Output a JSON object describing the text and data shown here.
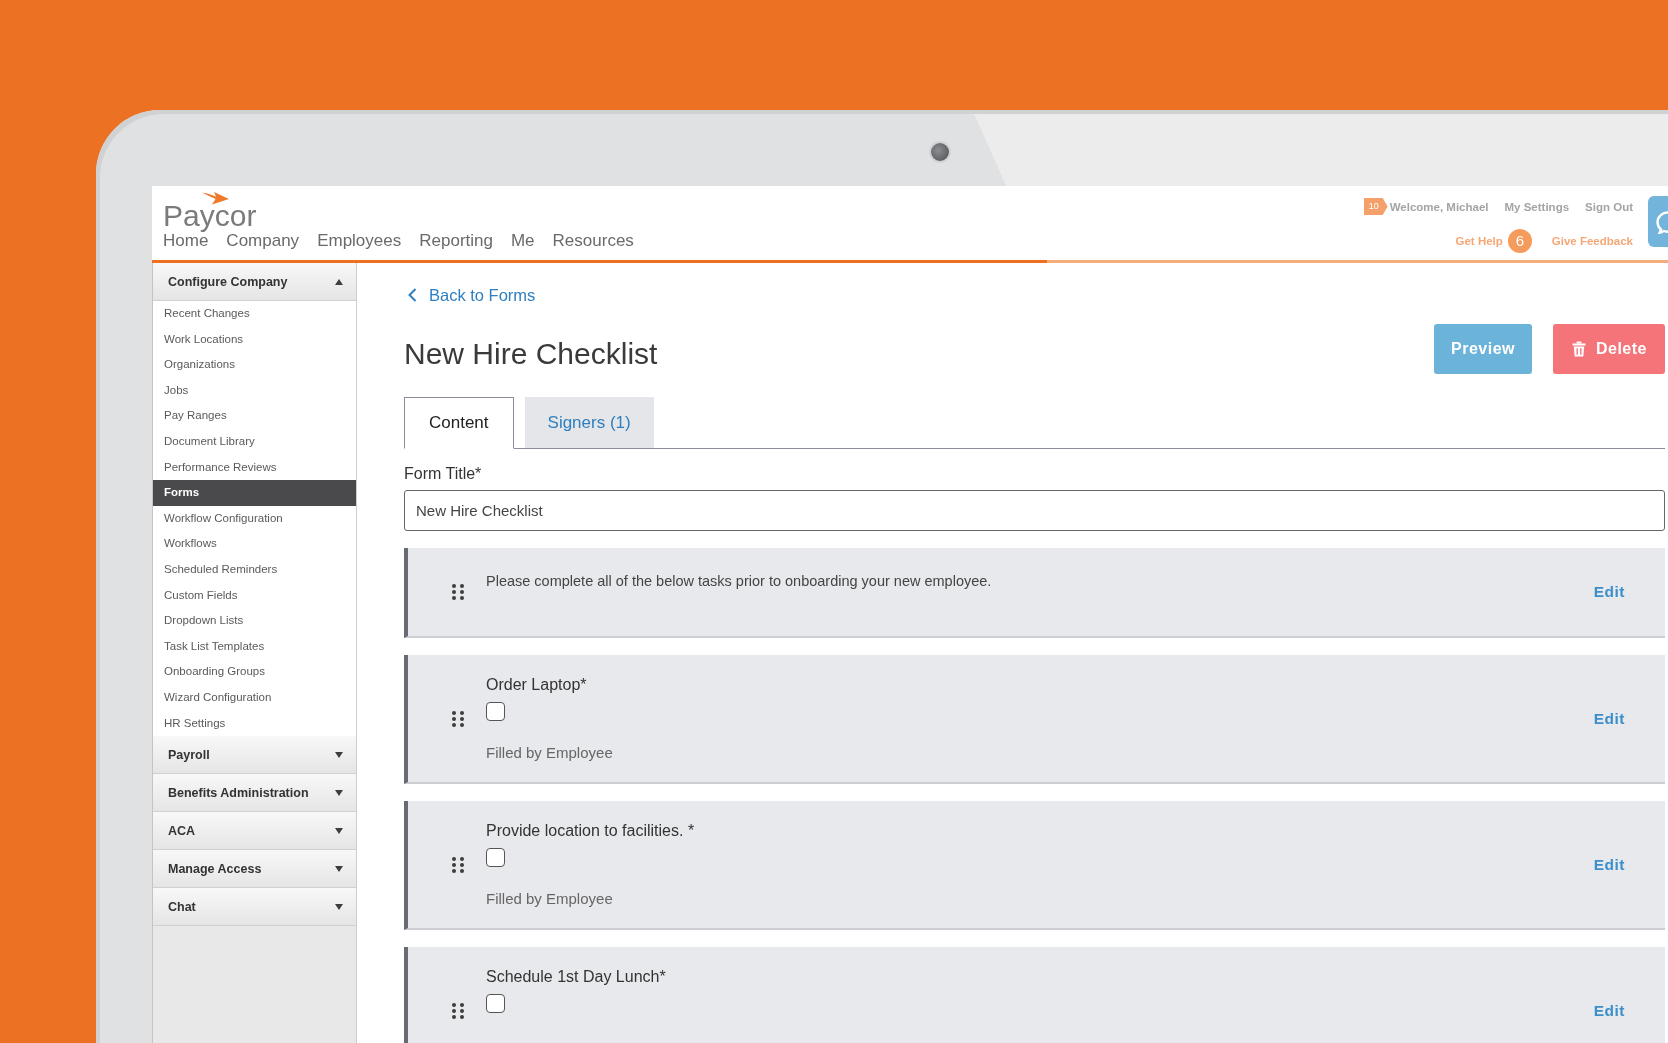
{
  "header": {
    "logo": "Paycor",
    "nav": [
      {
        "label": "Home"
      },
      {
        "label": "Company"
      },
      {
        "label": "Employees"
      },
      {
        "label": "Reporting"
      },
      {
        "label": "Me"
      },
      {
        "label": "Resources"
      }
    ],
    "notification_count": "10",
    "welcome": "Welcome, Michael",
    "account_links": [
      {
        "label": "My Settings"
      },
      {
        "label": "Sign Out"
      }
    ],
    "help": {
      "label": "Get Help",
      "count": "6"
    },
    "feedback": "Give Feedback"
  },
  "sidebar": {
    "sections": [
      {
        "label": "Configure Company",
        "expanded": true,
        "items": [
          {
            "label": "Recent Changes",
            "selected": false
          },
          {
            "label": "Work Locations",
            "selected": false
          },
          {
            "label": "Organizations",
            "selected": false
          },
          {
            "label": "Jobs",
            "selected": false
          },
          {
            "label": "Pay Ranges",
            "selected": false
          },
          {
            "label": "Document Library",
            "selected": false
          },
          {
            "label": "Performance Reviews",
            "selected": false
          },
          {
            "label": "Forms",
            "selected": true
          },
          {
            "label": "Workflow Configuration",
            "selected": false
          },
          {
            "label": "Workflows",
            "selected": false
          },
          {
            "label": "Scheduled Reminders",
            "selected": false
          },
          {
            "label": "Custom Fields",
            "selected": false
          },
          {
            "label": "Dropdown Lists",
            "selected": false
          },
          {
            "label": "Task List Templates",
            "selected": false
          },
          {
            "label": "Onboarding Groups",
            "selected": false
          },
          {
            "label": "Wizard Configuration",
            "selected": false
          },
          {
            "label": "HR Settings",
            "selected": false
          }
        ]
      },
      {
        "label": "Payroll",
        "expanded": false
      },
      {
        "label": "Benefits Administration",
        "expanded": false
      },
      {
        "label": "ACA",
        "expanded": false
      },
      {
        "label": "Manage Access",
        "expanded": false
      },
      {
        "label": "Chat",
        "expanded": false
      }
    ]
  },
  "back_link": "Back to Forms",
  "page_title": "New Hire Checklist",
  "actions": [
    {
      "kind": "preview",
      "label": "Preview"
    },
    {
      "kind": "delete",
      "label": "Delete"
    }
  ],
  "tabs": [
    {
      "label": "Content",
      "selected": true
    },
    {
      "label": "Signers (1)",
      "selected": false
    }
  ],
  "form_title": {
    "label": "Form Title*",
    "value": "New Hire Checklist"
  },
  "fields": [
    {
      "kind": "text",
      "text": "Please complete all of the below tasks prior to onboarding your new employee.",
      "action": "Edit"
    },
    {
      "kind": "checkbox",
      "label": "Order Laptop*",
      "checked": false,
      "filled_by": "Filled by Employee",
      "action": "Edit"
    },
    {
      "kind": "checkbox",
      "label": "Provide location to facilities. *",
      "checked": false,
      "filled_by": "Filled by Employee",
      "action": "Edit"
    },
    {
      "kind": "checkbox",
      "label": "Schedule 1st Day Lunch*",
      "checked": false,
      "action": "Edit"
    }
  ]
}
